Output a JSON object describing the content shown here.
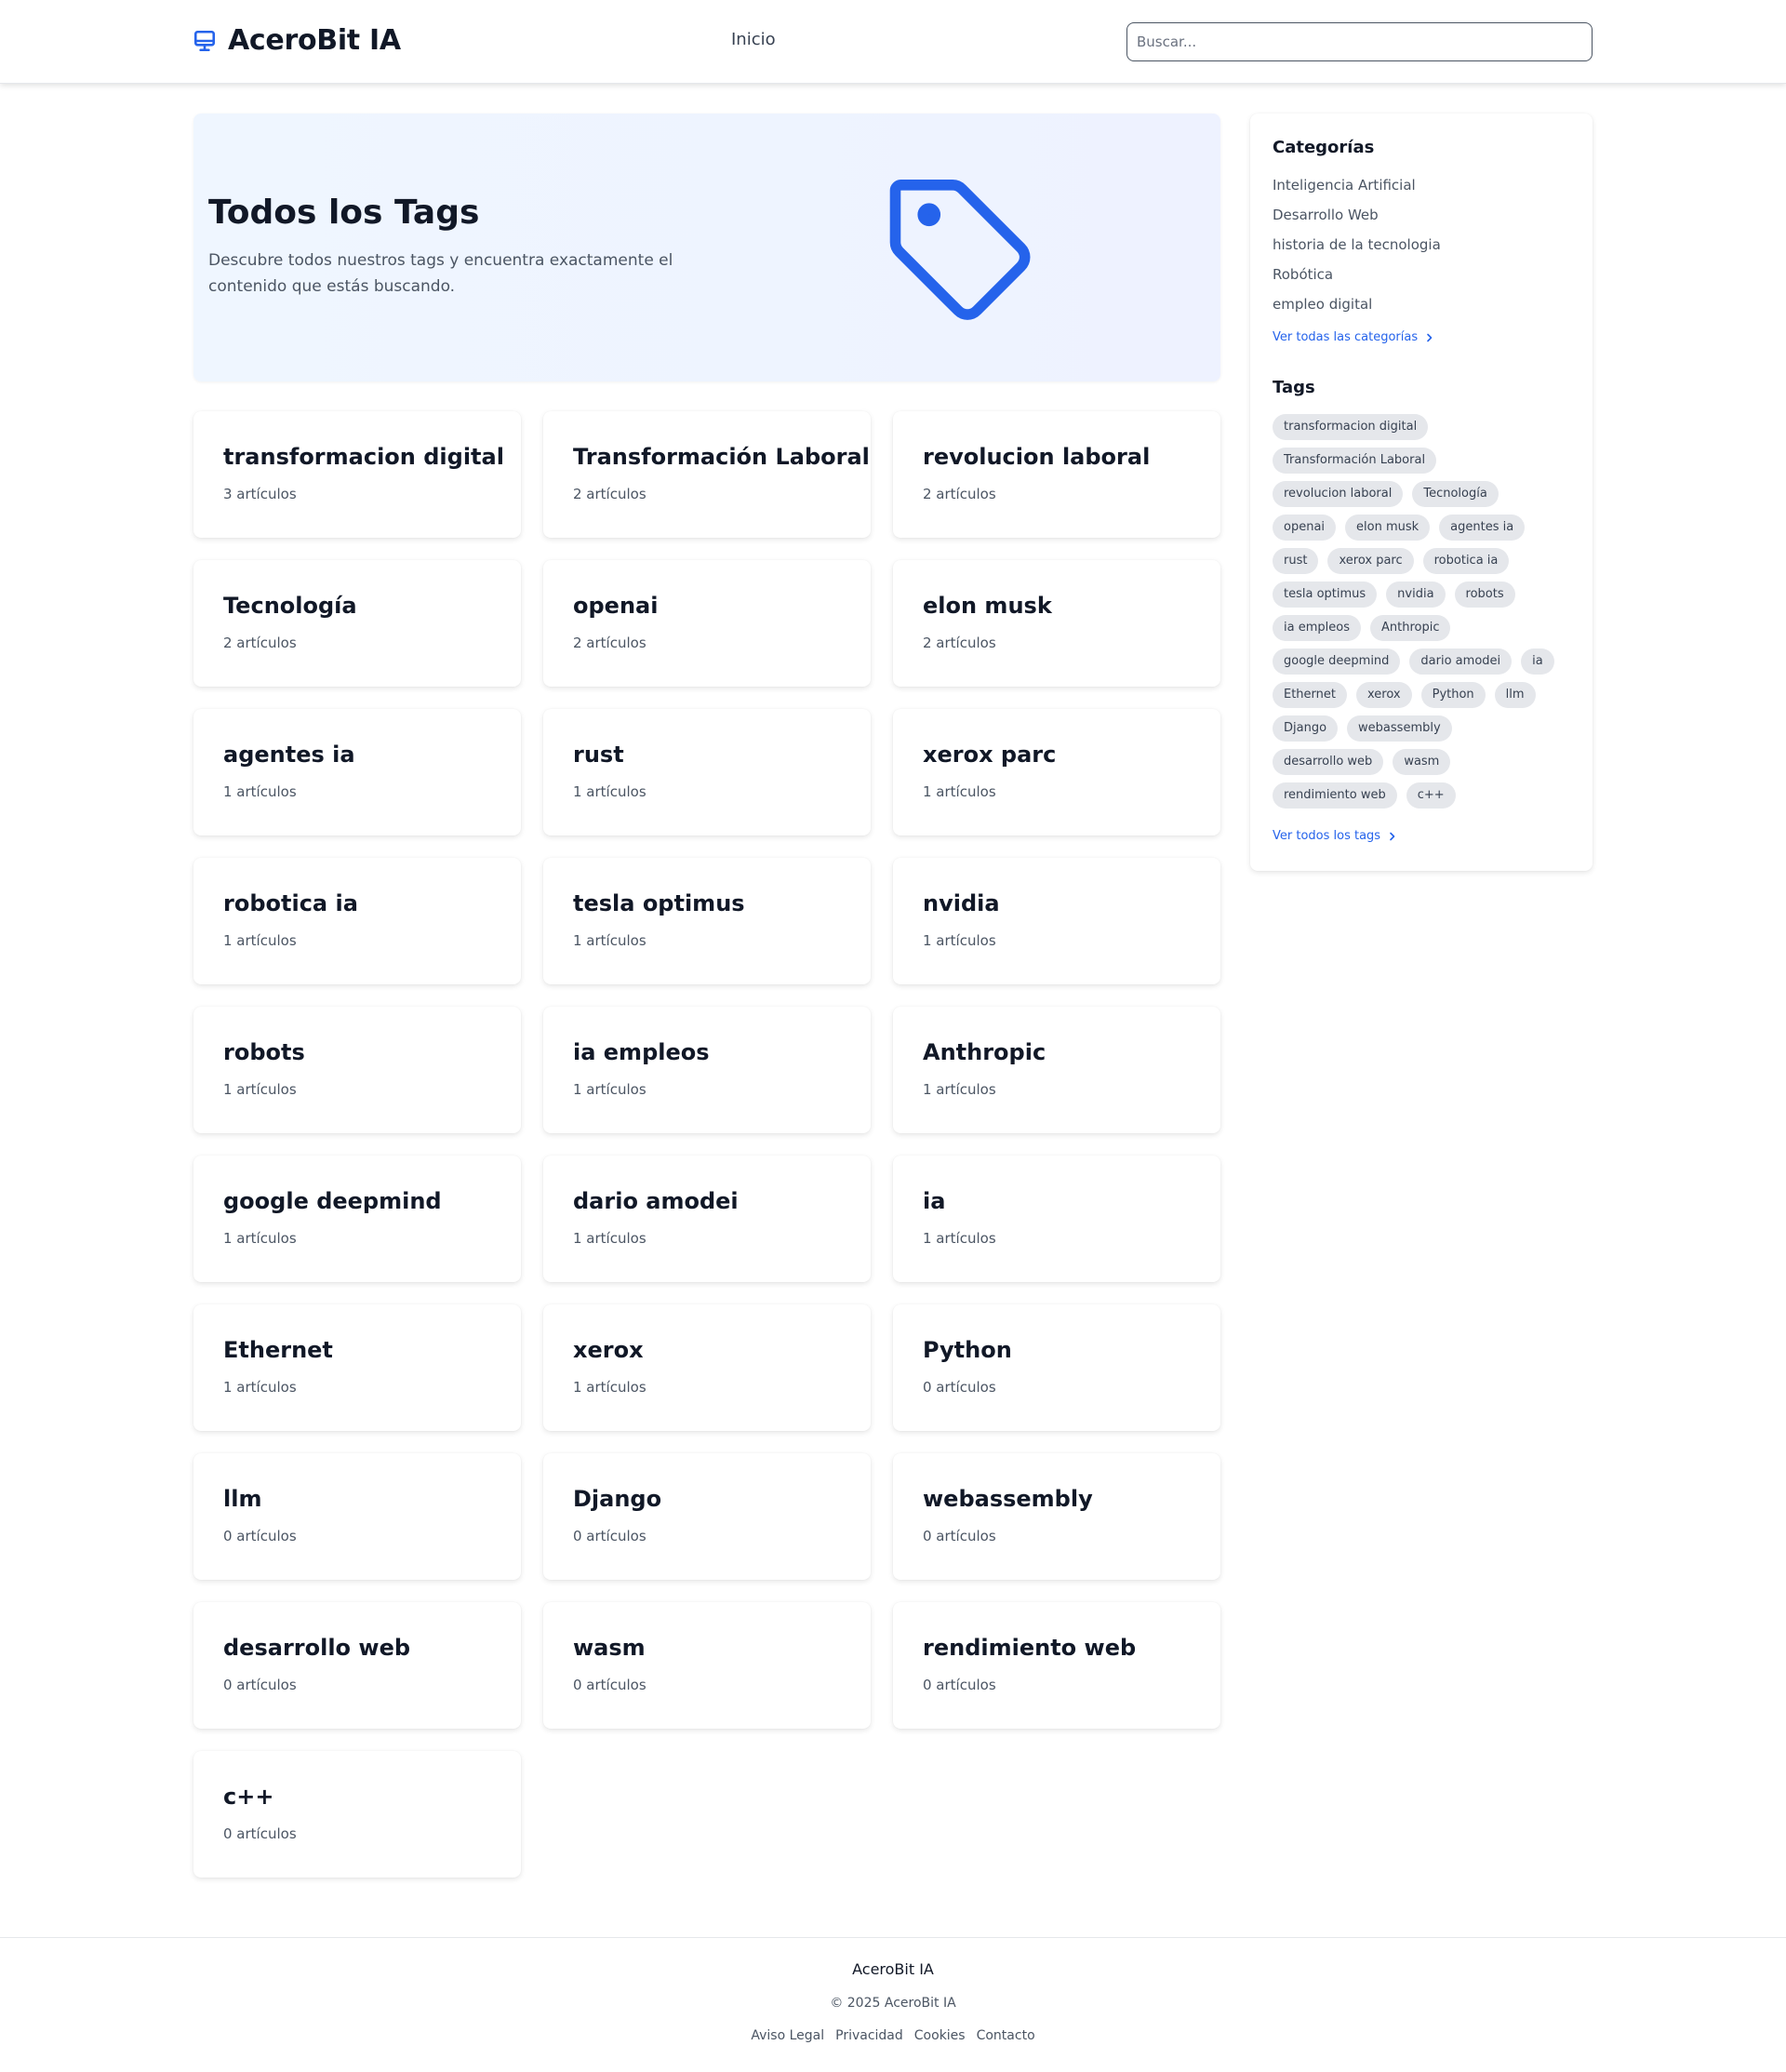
{
  "brand": {
    "name": "AceroBit IA",
    "icon": "monitor-icon",
    "accent": "#2563eb"
  },
  "nav": {
    "home_label": "Inicio"
  },
  "search": {
    "placeholder": "Buscar..."
  },
  "hero": {
    "title": "Todos los Tags",
    "description": "Descubre todos nuestros tags y encuentra exactamente el contenido que estás buscando.",
    "icon": "tag-icon"
  },
  "tags": [
    {
      "name": "transformacion digital",
      "count": "3 artículos"
    },
    {
      "name": "Transformación Laboral",
      "count": "2 artículos"
    },
    {
      "name": "revolucion laboral",
      "count": "2 artículos"
    },
    {
      "name": "Tecnología",
      "count": "2 artículos"
    },
    {
      "name": "openai",
      "count": "2 artículos"
    },
    {
      "name": "elon musk",
      "count": "2 artículos"
    },
    {
      "name": "agentes ia",
      "count": "1 artículos"
    },
    {
      "name": "rust",
      "count": "1 artículos"
    },
    {
      "name": "xerox parc",
      "count": "1 artículos"
    },
    {
      "name": "robotica ia",
      "count": "1 artículos"
    },
    {
      "name": "tesla optimus",
      "count": "1 artículos"
    },
    {
      "name": "nvidia",
      "count": "1 artículos"
    },
    {
      "name": "robots",
      "count": "1 artículos"
    },
    {
      "name": "ia empleos",
      "count": "1 artículos"
    },
    {
      "name": "Anthropic",
      "count": "1 artículos"
    },
    {
      "name": "google deepmind",
      "count": "1 artículos"
    },
    {
      "name": "dario amodei",
      "count": "1 artículos"
    },
    {
      "name": "ia",
      "count": "1 artículos"
    },
    {
      "name": "Ethernet",
      "count": "1 artículos"
    },
    {
      "name": "xerox",
      "count": "1 artículos"
    },
    {
      "name": "Python",
      "count": "0 artículos"
    },
    {
      "name": "llm",
      "count": "0 artículos"
    },
    {
      "name": "Django",
      "count": "0 artículos"
    },
    {
      "name": "webassembly",
      "count": "0 artículos"
    },
    {
      "name": "desarrollo web",
      "count": "0 artículos"
    },
    {
      "name": "wasm",
      "count": "0 artículos"
    },
    {
      "name": "rendimiento web",
      "count": "0 artículos"
    },
    {
      "name": "c++",
      "count": "0 artículos"
    }
  ],
  "sidebar": {
    "categories_heading": "Categorías",
    "categories": [
      "Inteligencia Artificial",
      "Desarrollo Web",
      "historia de la tecnologia",
      "Robótica",
      "empleo digital"
    ],
    "all_categories_link": "Ver todas las categorías",
    "tags_heading": "Tags",
    "tag_pills": [
      "transformacion digital",
      "Transformación Laboral",
      "revolucion laboral",
      "Tecnología",
      "openai",
      "elon musk",
      "agentes ia",
      "rust",
      "xerox parc",
      "robotica ia",
      "tesla optimus",
      "nvidia",
      "robots",
      "ia empleos",
      "Anthropic",
      "google deepmind",
      "dario amodei",
      "ia",
      "Ethernet",
      "xerox",
      "Python",
      "llm",
      "Django",
      "webassembly",
      "desarrollo web",
      "wasm",
      "rendimiento web",
      "c++"
    ],
    "all_tags_link": "Ver todos los tags"
  },
  "footer": {
    "brand": "AceroBit IA",
    "copyright": "© 2025 AceroBit IA",
    "links": [
      "Aviso Legal",
      "Privacidad",
      "Cookies",
      "Contacto"
    ]
  }
}
